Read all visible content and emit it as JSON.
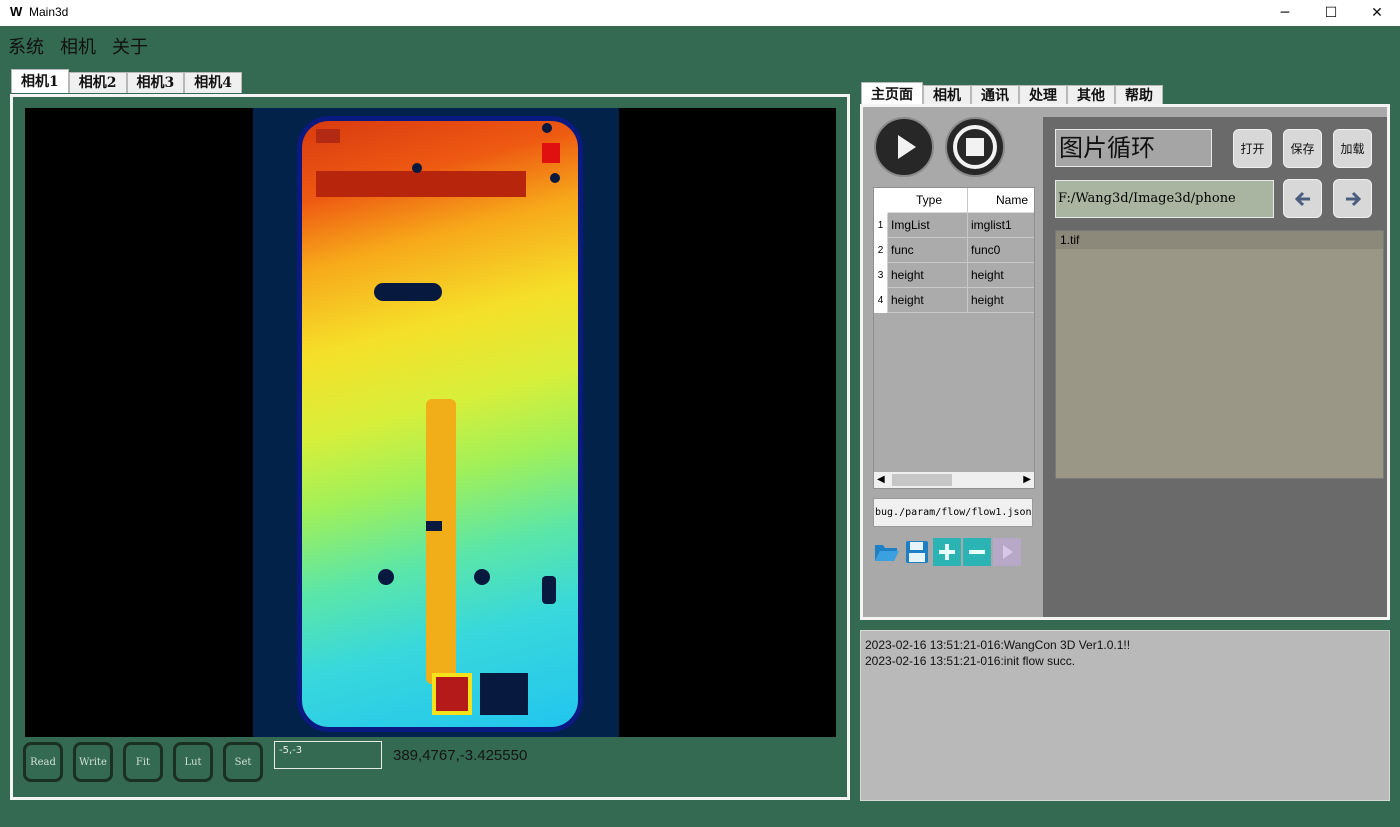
{
  "window": {
    "logo": "W",
    "title": "Main3d",
    "minimize_icon": "minimize-icon",
    "maximize_icon": "maximize-icon",
    "close_icon": "close-icon"
  },
  "menu": [
    "系统",
    "相机",
    "关于"
  ],
  "left_tabs": [
    "相机1",
    "相机2",
    "相机3",
    "相机4"
  ],
  "viewer": {
    "buttons": [
      "Read",
      "Write",
      "Fit",
      "Lut",
      "Set"
    ],
    "coord_input": "-5,-3",
    "readout": "389,4767,-3.425550"
  },
  "right_tabs": [
    "主页面",
    "相机",
    "通讯",
    "处理",
    "其他",
    "帮助"
  ],
  "flow_table": {
    "headers": [
      "Type",
      "Name"
    ],
    "rows": [
      {
        "num": "1",
        "type": "ImgList",
        "name": "imglist1"
      },
      {
        "num": "2",
        "type": "func",
        "name": "func0"
      },
      {
        "num": "3",
        "type": "height",
        "name": "height"
      },
      {
        "num": "4",
        "type": "height",
        "name": "height"
      }
    ]
  },
  "flow_path": "bug./param/flow/flow1.json",
  "image_loop": {
    "label": "图片循环",
    "open": "打开",
    "save": "保存",
    "load": "加载",
    "path": "F:/Wang3d/Image3d/phone",
    "files": [
      "1.tif"
    ]
  },
  "log": [
    "2023-02-16 13:51:21-016:WangCon 3D Ver1.0.1!!",
    "2023-02-16 13:51:21-016:init flow succ."
  ],
  "colors": {
    "background": "#346a52",
    "panel_border": "#f4f4f4",
    "accent_tool": "#2cb4b4"
  }
}
